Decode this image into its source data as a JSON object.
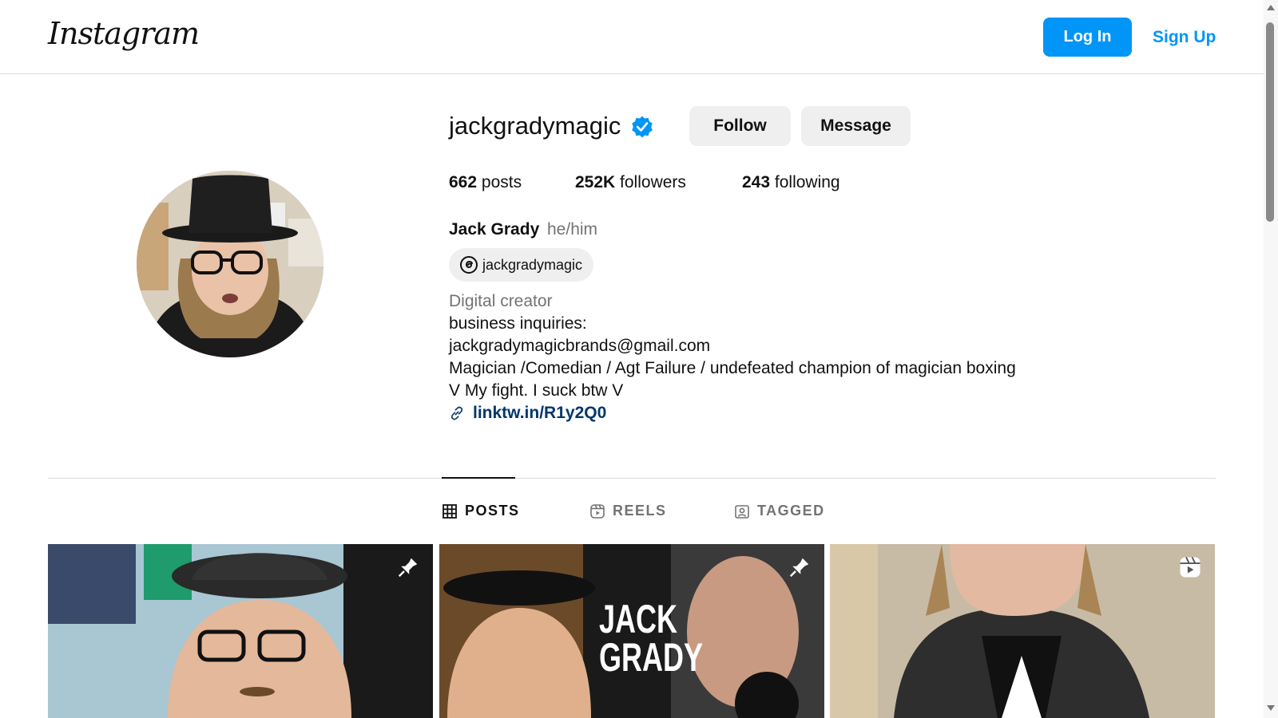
{
  "header": {
    "logo": "Instagram",
    "login_label": "Log In",
    "signup_label": "Sign Up"
  },
  "profile": {
    "username": "jackgradymagic",
    "verified": true,
    "follow_label": "Follow",
    "message_label": "Message",
    "stats": {
      "posts": "662",
      "posts_label": "posts",
      "followers": "252K",
      "followers_label": "followers",
      "following": "243",
      "following_label": "following"
    },
    "full_name": "Jack Grady",
    "pronouns": "he/him",
    "threads_handle": "jackgradymagic",
    "category": "Digital creator",
    "bio_lines": [
      "business inquiries:",
      "jackgradymagicbrands@gmail.com",
      "Magician /Comedian / Agt Failure / undefeated champion of magician boxing",
      "V My fight. I suck btw V"
    ],
    "link": "linktw.in/R1y2Q0"
  },
  "tabs": [
    {
      "label": "POSTS",
      "active": true
    },
    {
      "label": "REELS",
      "active": false
    },
    {
      "label": "TAGGED",
      "active": false
    }
  ],
  "posts": [
    {
      "badge": "pin-icon"
    },
    {
      "badge": "pin-icon",
      "overlay_text": "JACK GRADY"
    },
    {
      "badge": "reel-icon"
    }
  ],
  "colors": {
    "accent": "#0095f6",
    "link": "#00376b",
    "muted": "#737373",
    "button_bg": "#efefef",
    "verified": "#0095f6"
  }
}
